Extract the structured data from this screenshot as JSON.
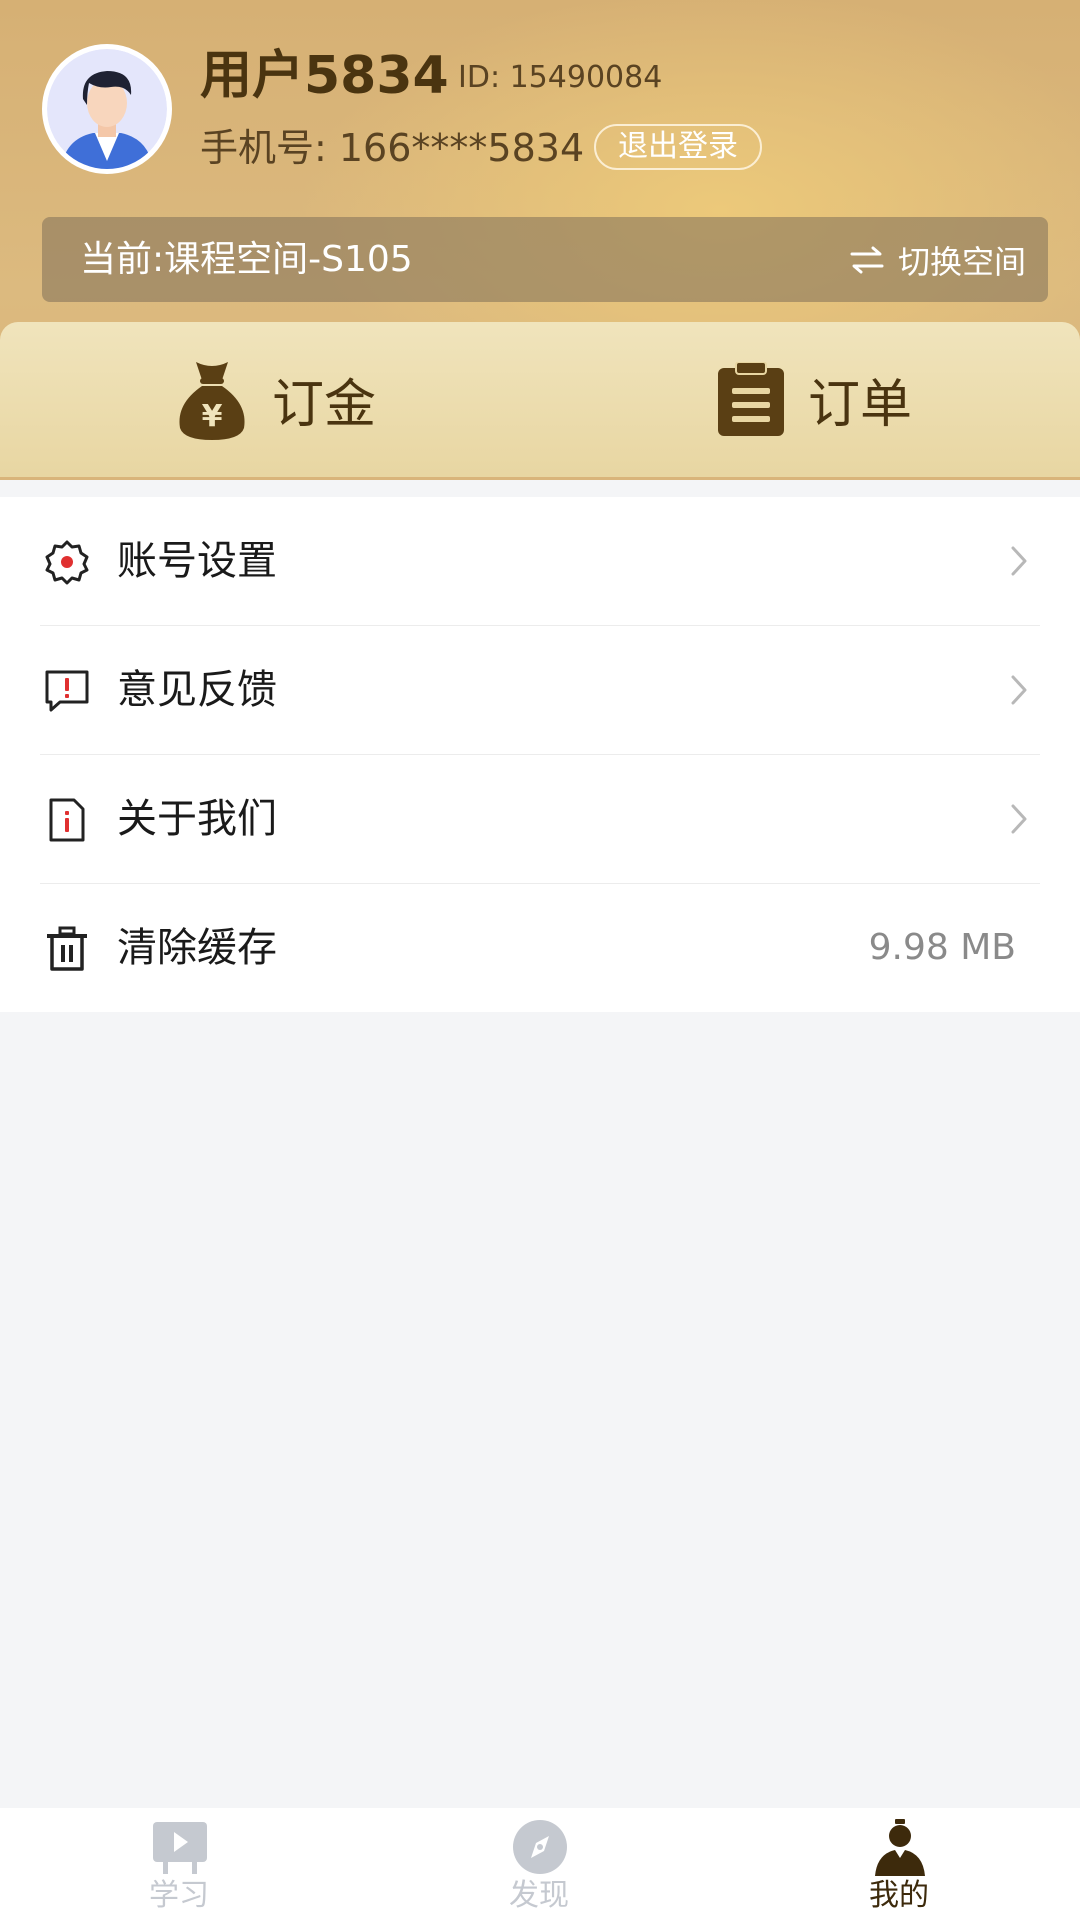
{
  "profile": {
    "username": "用户5834",
    "user_id": "ID: 15490084",
    "phone": "手机号: 166****5834",
    "logout_label": "退出登录"
  },
  "space": {
    "current": "当前:课程空间-S105",
    "switch_label": "切换空间"
  },
  "quick_actions": [
    {
      "label": "订金",
      "icon": "money-bag-icon"
    },
    {
      "label": "订单",
      "icon": "clipboard-icon"
    }
  ],
  "menu": {
    "items": [
      {
        "label": "账号设置",
        "icon": "gear-icon"
      },
      {
        "label": "意见反馈",
        "icon": "feedback-icon"
      },
      {
        "label": "关于我们",
        "icon": "info-document-icon"
      },
      {
        "label": "清除缓存",
        "icon": "trash-icon",
        "value": "9.98 MB"
      }
    ]
  },
  "tabbar": {
    "tabs": [
      {
        "label": "学习",
        "icon": "play-board-icon",
        "active": false
      },
      {
        "label": "发现",
        "icon": "compass-icon",
        "active": false
      },
      {
        "label": "我的",
        "icon": "person-icon",
        "active": true
      }
    ]
  },
  "colors": {
    "header_gold": "#d6b074",
    "accent_brown": "#4a3410",
    "tab_inactive": "#c5c9d0"
  }
}
